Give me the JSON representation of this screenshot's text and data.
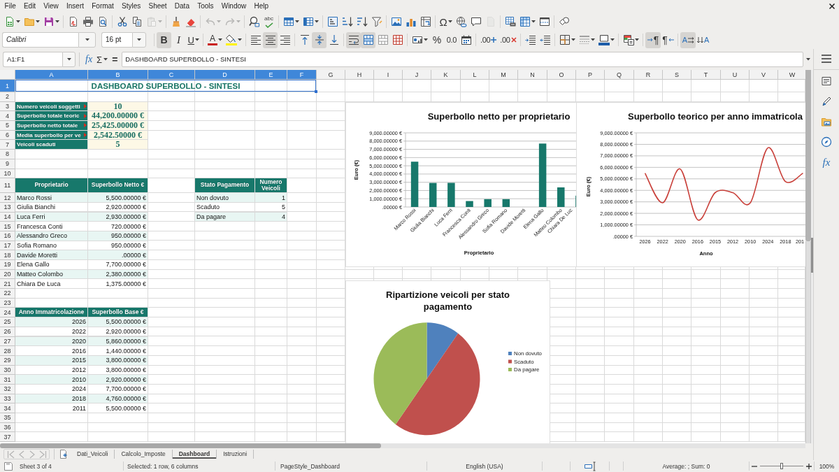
{
  "menu_bar": {
    "items": [
      "File",
      "Edit",
      "View",
      "Insert",
      "Format",
      "Styles",
      "Sheet",
      "Data",
      "Tools",
      "Window",
      "Help"
    ]
  },
  "standard_toolbar": {
    "buttons": [
      {
        "disabled": false
      },
      {
        "disabled": false
      },
      {
        "disabled": false
      },
      {
        "disabled": false
      },
      {
        "disabled": false
      },
      {
        "disabled": false
      },
      {
        "disabled": false
      },
      {
        "disabled": false
      },
      {
        "disabled": true
      },
      {
        "disabled": false
      },
      {
        "disabled": false
      },
      {
        "disabled": true
      },
      {
        "disabled": true
      },
      {
        "disabled": false
      },
      {
        "label": "abc",
        "disabled": false
      },
      {
        "disabled": false
      },
      {
        "disabled": false
      },
      {
        "disabled": false
      },
      {
        "disabled": false
      },
      {
        "disabled": false
      },
      {
        "disabled": false
      },
      {
        "disabled": false
      },
      {
        "disabled": false
      },
      {
        "disabled": false
      },
      {
        "label": "Ω",
        "disabled": false
      },
      {
        "disabled": false
      },
      {
        "disabled": false
      },
      {
        "disabled": true
      },
      {
        "disabled": false
      },
      {
        "disabled": false
      },
      {
        "disabled": false
      },
      {
        "disabled": false
      }
    ]
  },
  "formatting_toolbar": {
    "font_name": "Calibri",
    "font_size": "16 pt",
    "buttons": [
      {
        "label": "B",
        "pressed": true
      },
      {
        "label": "I",
        "pressed": false
      },
      {
        "label": "U",
        "pressed": false
      },
      {
        "label": "A",
        "pressed": false
      },
      {
        "pressed": false
      },
      {
        "pressed": false
      },
      {
        "pressed": true
      },
      {
        "pressed": false
      },
      {
        "pressed": false
      },
      {
        "pressed": true
      },
      {
        "pressed": false
      },
      {
        "pressed": true
      },
      {
        "pressed": true
      },
      {
        "pressed": false
      },
      {
        "pressed": false
      },
      {
        "pressed": false
      },
      {
        "label": "%",
        "pressed": false
      },
      {
        "label": "0.0",
        "pressed": false
      },
      {
        "pressed": false
      },
      {
        "label": ".00",
        "pressed": false
      },
      {
        "label": ".00",
        "pressed": false
      },
      {
        "pressed": false
      },
      {
        "pressed": false
      },
      {
        "pressed": false
      },
      {
        "pressed": false
      },
      {
        "pressed": false
      },
      {
        "pressed": false
      },
      {
        "label": "¶",
        "pressed": true
      },
      {
        "label": "¶",
        "pressed": false
      },
      {
        "label": "A",
        "pressed": true
      },
      {
        "label": "A",
        "pressed": false
      }
    ]
  },
  "formula_bar": {
    "name_box": "A1:F1",
    "function_wizard": "fx",
    "sum": "Σ",
    "formula": "=",
    "content": "DASHBOARD SUPERBOLLO - SINTESI"
  },
  "sheet": {
    "columns": [
      {
        "label": "A",
        "selected": true
      },
      {
        "label": "B",
        "selected": true
      },
      {
        "label": "C",
        "selected": true
      },
      {
        "label": "D",
        "selected": true
      },
      {
        "label": "E",
        "selected": true
      },
      {
        "label": "F",
        "selected": true
      },
      {
        "label": "G",
        "selected": false
      },
      {
        "label": "H",
        "selected": false
      },
      {
        "label": "I",
        "selected": false
      },
      {
        "label": "J",
        "selected": false
      },
      {
        "label": "K",
        "selected": false
      },
      {
        "label": "L",
        "selected": false
      },
      {
        "label": "M",
        "selected": false
      },
      {
        "label": "N",
        "selected": false
      },
      {
        "label": "O",
        "selected": false
      },
      {
        "label": "P",
        "selected": false
      },
      {
        "label": "Q",
        "selected": false
      },
      {
        "label": "R",
        "selected": false
      },
      {
        "label": "S",
        "selected": false
      },
      {
        "label": "T",
        "selected": false
      },
      {
        "label": "U",
        "selected": false
      },
      {
        "label": "V",
        "selected": false
      },
      {
        "label": "W",
        "selected": false
      }
    ],
    "rows": [
      {
        "label": "1",
        "selected": true
      },
      {
        "label": "2",
        "selected": false
      },
      {
        "label": "3",
        "selected": false
      },
      {
        "label": "4",
        "selected": false
      },
      {
        "label": "5",
        "selected": false
      },
      {
        "label": "6",
        "selected": false
      },
      {
        "label": "7",
        "selected": false
      },
      {
        "label": "8",
        "selected": false
      },
      {
        "label": "9",
        "selected": false
      },
      {
        "label": "10",
        "selected": false
      },
      {
        "label": "11",
        "selected": false
      },
      {
        "label": "12",
        "selected": false
      },
      {
        "label": "13",
        "selected": false
      },
      {
        "label": "14",
        "selected": false
      },
      {
        "label": "15",
        "selected": false
      },
      {
        "label": "16",
        "selected": false
      },
      {
        "label": "17",
        "selected": false
      },
      {
        "label": "18",
        "selected": false
      },
      {
        "label": "19",
        "selected": false
      },
      {
        "label": "20",
        "selected": false
      },
      {
        "label": "21",
        "selected": false
      },
      {
        "label": "22",
        "selected": false
      },
      {
        "label": "23",
        "selected": false
      },
      {
        "label": "24",
        "selected": false
      },
      {
        "label": "25",
        "selected": false
      },
      {
        "label": "26",
        "selected": false
      },
      {
        "label": "27",
        "selected": false
      },
      {
        "label": "28",
        "selected": false
      },
      {
        "label": "29",
        "selected": false
      },
      {
        "label": "30",
        "selected": false
      },
      {
        "label": "31",
        "selected": false
      },
      {
        "label": "32",
        "selected": false
      },
      {
        "label": "33",
        "selected": false
      },
      {
        "label": "34",
        "selected": false
      },
      {
        "label": "35",
        "selected": false
      },
      {
        "label": "36",
        "selected": false
      },
      {
        "label": "37",
        "selected": false
      }
    ],
    "title": {
      "text": "DASHBOARD SUPERBOLLO - SINTESI",
      "selected": true
    },
    "kpis": [
      {
        "label": "Numero veicoli soggetti",
        "value": "10",
        "clipped": true
      },
      {
        "label": "Superbollo totale teoric",
        "value": "44,200.00000 €",
        "clipped": true
      },
      {
        "label": "Superbollo netto totale",
        "value": "25,425.00000 €",
        "clipped": true
      },
      {
        "label": "Media superbollo per ve",
        "value": "2,542.50000 €",
        "clipped": true
      },
      {
        "label": "Veicoli scaduti",
        "value": "5",
        "clipped": false
      }
    ],
    "owner_table": {
      "columns": [
        "Proprietario",
        "Superbollo Netto €"
      ],
      "rows": [
        [
          "Marco Rossi",
          "5,500.00000 €"
        ],
        [
          "Giulia Bianchi",
          "2,920.00000 €"
        ],
        [
          "Luca Ferri",
          "2,930.00000 €"
        ],
        [
          "Francesca Conti",
          "720.00000 €"
        ],
        [
          "Alessandro Greco",
          "950.00000 €"
        ],
        [
          "Sofia Romano",
          "950.00000 €"
        ],
        [
          "Davide Moretti",
          ".00000 €"
        ],
        [
          "Elena Gallo",
          "7,700.00000 €"
        ],
        [
          "Matteo Colombo",
          "2,380.00000 €"
        ],
        [
          "Chiara De Luca",
          "1,375.00000 €"
        ]
      ]
    },
    "status_table": {
      "columns": [
        "Stato Pagamento",
        "Numero Veicoli"
      ],
      "rows": [
        [
          "Non dovuto",
          "1"
        ],
        [
          "Scaduto",
          "5"
        ],
        [
          "Da pagare",
          "4"
        ]
      ]
    },
    "year_table": {
      "columns": [
        "Anno Immatricolazione",
        "Superbollo Base €"
      ],
      "rows": [
        [
          "2026",
          "5,500.00000 €"
        ],
        [
          "2022",
          "2,920.00000 €"
        ],
        [
          "2020",
          "5,860.00000 €"
        ],
        [
          "2016",
          "1,440.00000 €"
        ],
        [
          "2015",
          "3,800.00000 €"
        ],
        [
          "2012",
          "3,800.00000 €"
        ],
        [
          "2010",
          "2,920.00000 €"
        ],
        [
          "2024",
          "7,700.00000 €"
        ],
        [
          "2018",
          "4,760.00000 €"
        ],
        [
          "2011",
          "5,500.00000 €"
        ]
      ]
    },
    "charts": [
      {
        "chart_data": {
          "type": "bar",
          "title": "Superbollo netto per proprietario",
          "xlabel": "Proprietario",
          "ylabel": "Euro (€)",
          "categories": [
            "Marco Rossi",
            "Giulia Bianchi",
            "Luca Ferri",
            "Francesca Conti",
            "Alessandro Greco",
            "Sofia Romano",
            "Davide Moretti",
            "Elena Gallo",
            "Matteo Colombo",
            "Chiara De Luc"
          ],
          "series": [
            {
              "color": "#17786b",
              "values": [
                5500,
                2920,
                2930,
                720,
                950,
                950,
                0,
                7700,
                2380,
                1375
              ]
            }
          ],
          "ylim": [
            0,
            9000
          ],
          "yticks": [
            {
              "value": 0,
              "label": ".00000 €"
            },
            {
              "value": 1000,
              "label": "1,000.00000 €"
            },
            {
              "value": 2000,
              "label": "2,000.00000 €"
            },
            {
              "value": 3000,
              "label": "3,000.00000 €"
            },
            {
              "value": 4000,
              "label": "4,000.00000 €"
            },
            {
              "value": 5000,
              "label": "5,000.00000 €"
            },
            {
              "value": 6000,
              "label": "6,000.00000 €"
            },
            {
              "value": 7000,
              "label": "7,000.00000 €"
            },
            {
              "value": 8000,
              "label": "8,000.00000 €"
            },
            {
              "value": 9000,
              "label": "9,000.00000 €"
            }
          ],
          "grid": true
        }
      },
      {
        "chart_data": {
          "type": "line",
          "title": "Superbollo teorico per anno immatricola",
          "xlabel": "Anno",
          "ylabel": "Euro (€)",
          "categories": [
            "2026",
            "2022",
            "2020",
            "2016",
            "2015",
            "2012",
            "2010",
            "2024",
            "2018",
            "201"
          ],
          "series": [
            {
              "color": "#c9403a",
              "values": [
                5500,
                2920,
                5860,
                1440,
                3800,
                3800,
                2920,
                7700,
                4760,
                5500
              ]
            }
          ],
          "ylim": [
            0,
            9000
          ],
          "yticks": [
            {
              "value": 0,
              "label": ".00000 €"
            },
            {
              "value": 1000,
              "label": "1,000.00000 €"
            },
            {
              "value": 2000,
              "label": "2,000.00000 €"
            },
            {
              "value": 3000,
              "label": "3,000.00000 €"
            },
            {
              "value": 4000,
              "label": "4,000.00000 €"
            },
            {
              "value": 5000,
              "label": "5,000.00000 €"
            },
            {
              "value": 6000,
              "label": "6,000.00000 €"
            },
            {
              "value": 7000,
              "label": "7,000.00000 €"
            },
            {
              "value": 8000,
              "label": "8,000.00000 €"
            },
            {
              "value": 9000,
              "label": "9,000.00000 €"
            }
          ],
          "grid": true
        }
      },
      {
        "chart_data": {
          "type": "pie",
          "title": "Ripartizione veicoli per stato pagamento",
          "categories": [
            "Non dovuto",
            "Scaduto",
            "Da pagare"
          ],
          "values": [
            10,
            50,
            40
          ],
          "legend": "right"
        }
      }
    ]
  },
  "sheet_tabs": [
    {
      "label": "Dati_Veicoli",
      "selected": false
    },
    {
      "label": "Calcolo_Imposte",
      "selected": false
    },
    {
      "label": "Dashboard",
      "selected": true
    },
    {
      "label": "Istruzioni",
      "selected": false
    }
  ],
  "sidebar": {
    "function_button": "fx"
  },
  "status_bar": {
    "sheet": "Sheet 3 of 4",
    "selection": "Selected: 1 row, 6 columns",
    "page_style": "PageStyle_Dashboard",
    "language": "English (USA)",
    "summary": "Average: ; Sum: 0",
    "zoom": {
      "level": 0.5,
      "reading": "100%"
    }
  }
}
